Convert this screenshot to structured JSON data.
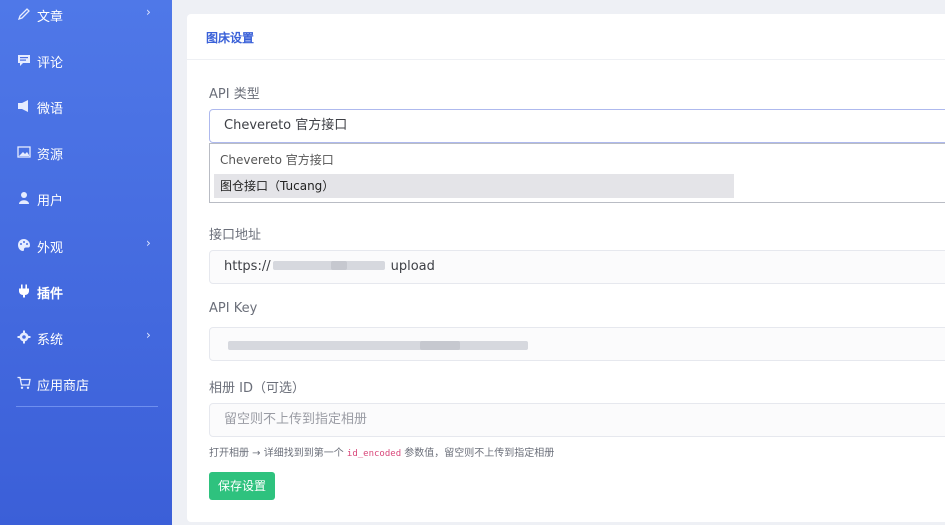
{
  "sidebar": {
    "items": [
      {
        "label": "文章",
        "icon": "pencil-icon",
        "chevron": "›"
      },
      {
        "label": "评论",
        "icon": "comment-icon",
        "chevron": ""
      },
      {
        "label": "微语",
        "icon": "speaker-icon",
        "chevron": ""
      },
      {
        "label": "资源",
        "icon": "image-icon",
        "chevron": ""
      },
      {
        "label": "用户",
        "icon": "user-icon",
        "chevron": ""
      },
      {
        "label": "外观",
        "icon": "palette-icon",
        "chevron": "›"
      },
      {
        "label": "插件",
        "icon": "plug-icon",
        "chevron": ""
      },
      {
        "label": "系统",
        "icon": "gear-icon",
        "chevron": "›"
      },
      {
        "label": "应用商店",
        "icon": "cart-icon",
        "chevron": ""
      }
    ],
    "active_index": 6
  },
  "card": {
    "title": "图床设置"
  },
  "form": {
    "api_type_label": "API 类型",
    "api_type_value": "Chevereto 官方接口",
    "api_type_options": [
      "Chevereto 官方接口",
      "图仓接口（Tucang）"
    ],
    "endpoint_label": "接口地址",
    "endpoint_prefix": "https://",
    "endpoint_suffix": "upload",
    "api_key_label": "API Key",
    "album_label": "相册 ID（可选）",
    "album_placeholder": "留空则不上传到指定相册",
    "hint_before": "打开相册 → 详细找到到第一个 ",
    "hint_code": "id_encoded",
    "hint_after": " 参数值，留空则不上传到指定相册",
    "save_label": "保存设置"
  },
  "colors": {
    "sidebar": "#4a6fe3",
    "accent": "#3a61d8",
    "save_button": "#2ec27e"
  }
}
